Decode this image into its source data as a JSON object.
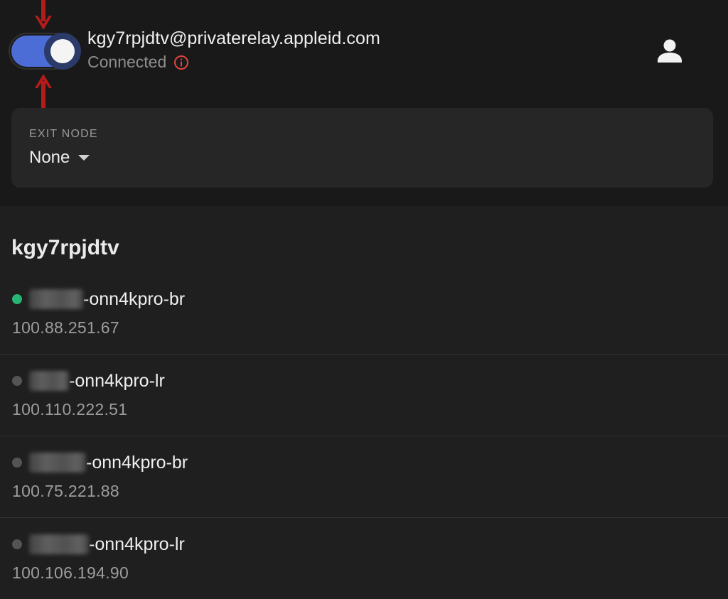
{
  "header": {
    "account_email": "kgy7rpjdtv@privaterelay.appleid.com",
    "status_text": "Connected",
    "toggle_on": true,
    "colors": {
      "toggle_track": "#4d6dd6",
      "annotation_arrow": "#b41b1b",
      "warning": "#e0443e"
    },
    "icons": {
      "info": "info-circle-icon",
      "account": "person-icon"
    }
  },
  "exit_node": {
    "label": "EXIT NODE",
    "value": "None",
    "icon": "caret-down-icon"
  },
  "tailnet": {
    "title": "kgy7rpjdtv",
    "devices": [
      {
        "name_suffix": "-onn4kpro-br",
        "ip": "100.88.251.67",
        "online": true
      },
      {
        "name_suffix": "-onn4kpro-lr",
        "ip": "100.110.222.51",
        "online": false
      },
      {
        "name_suffix": "-onn4kpro-br",
        "ip": "100.75.221.88",
        "online": false
      },
      {
        "name_suffix": "-onn4kpro-lr",
        "ip": "100.106.194.90",
        "online": false
      }
    ],
    "colors": {
      "online_dot": "#26b574",
      "offline_dot": "#545454"
    }
  }
}
